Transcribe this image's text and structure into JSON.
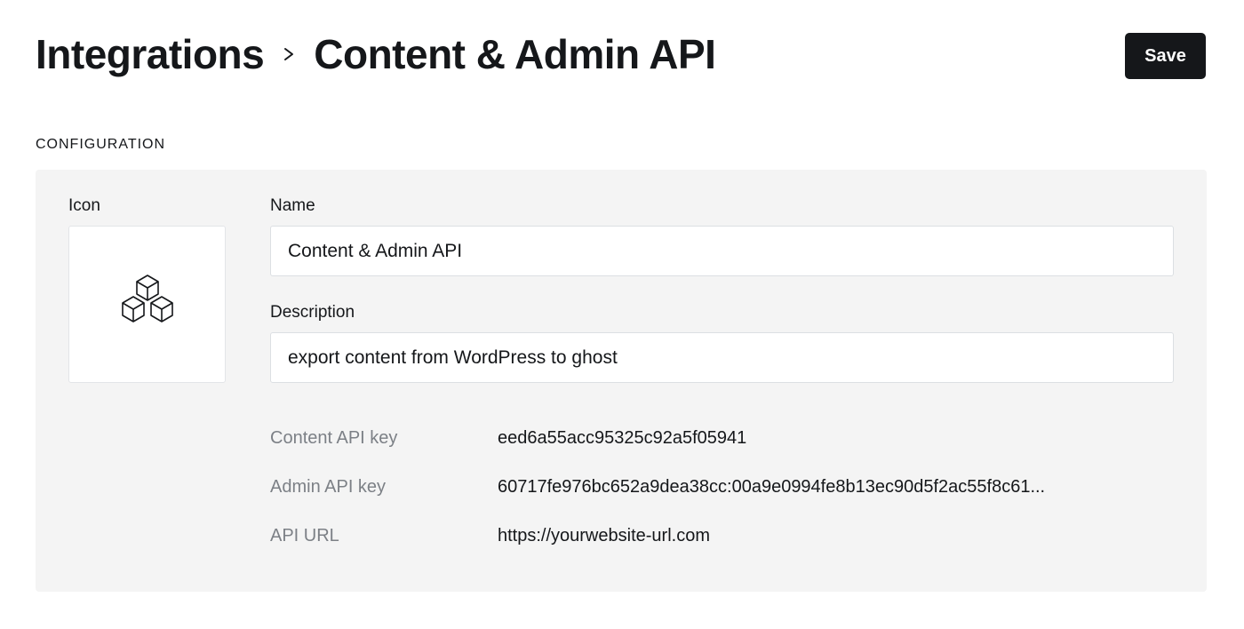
{
  "header": {
    "parent_crumb": "Integrations",
    "current_crumb": "Content & Admin API",
    "separator_icon": "chevron-right-icon",
    "save_label": "Save"
  },
  "configuration": {
    "section_label": "CONFIGURATION",
    "icon_label": "Icon",
    "icon_name": "cubes-icon",
    "name_label": "Name",
    "name_value": "Content & Admin API",
    "description_label": "Description",
    "description_value": "export content from WordPress to ghost",
    "api_details": [
      {
        "label": "Content API key",
        "value": "eed6a55acc95325c92a5f05941"
      },
      {
        "label": "Admin API key",
        "value": "60717fe976bc652a9dea38cc:00a9e0994fe8b13ec90d5f2ac55f8c61..."
      },
      {
        "label": "API URL",
        "value": "https://yourwebsite-url.com"
      }
    ]
  },
  "colors": {
    "primary_text": "#15171a",
    "muted_text": "#7c8086",
    "panel_background": "#f4f4f4",
    "button_background": "#15171a"
  }
}
